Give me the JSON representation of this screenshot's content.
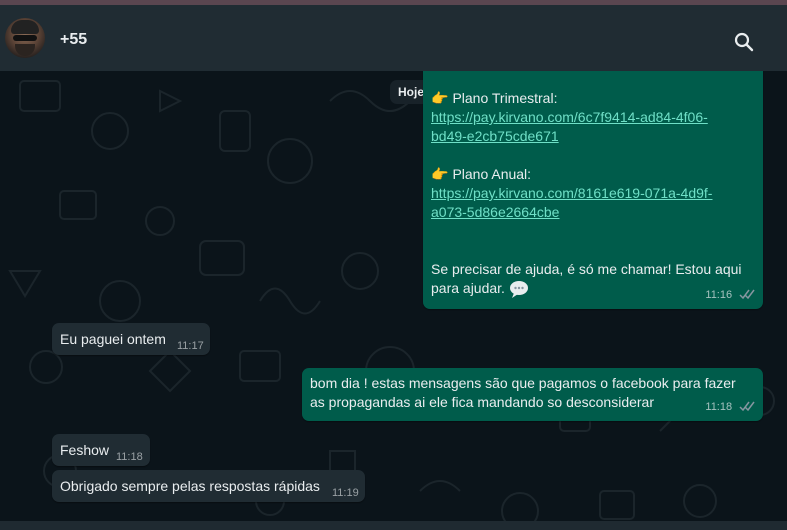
{
  "header": {
    "contact_name": "+55"
  },
  "chat": {
    "date_label": "Hoje",
    "messages": [
      {
        "direction": "out",
        "plan1_label": "Plano Trimestral:",
        "plan1_link_line1": "https://pay.kirvano.com/6c7f9414-ad84-4f06-",
        "plan1_link_line2": "bd49-e2cb75cde671",
        "plan2_label": "Plano Anual:",
        "plan2_link_line1": "https://pay.kirvano.com/8161e619-071a-4d9f-",
        "plan2_link_line2": "a073-5d86e2664cbe",
        "help_line1": "Se precisar de ajuda, é só me chamar! Estou aqui",
        "help_line2": "para ajudar.",
        "time": "11:16"
      },
      {
        "direction": "in",
        "text": "Eu paguei ontem",
        "time": "11:17"
      },
      {
        "direction": "out",
        "line1": "bom dia ! estas mensagens são que pagamos o facebook para fazer",
        "line2": "as propagandas ai ele fica mandando so desconsiderar",
        "time": "11:18"
      },
      {
        "direction": "in",
        "text": "Feshow",
        "time": "11:18"
      },
      {
        "direction": "in",
        "text": "Obrigado sempre pelas respostas rápidas",
        "time": "11:19"
      }
    ]
  },
  "colors": {
    "header_bg": "#202c33",
    "chat_bg": "#0b141a",
    "outgoing_bubble": "#005c4b",
    "incoming_bubble": "#202c33",
    "read_tick": "#8696a0"
  },
  "icons": {
    "search": "search-icon",
    "point_right": "point-right-emoji",
    "speech": "speech-bubble-emoji",
    "read": "double-check-icon"
  }
}
